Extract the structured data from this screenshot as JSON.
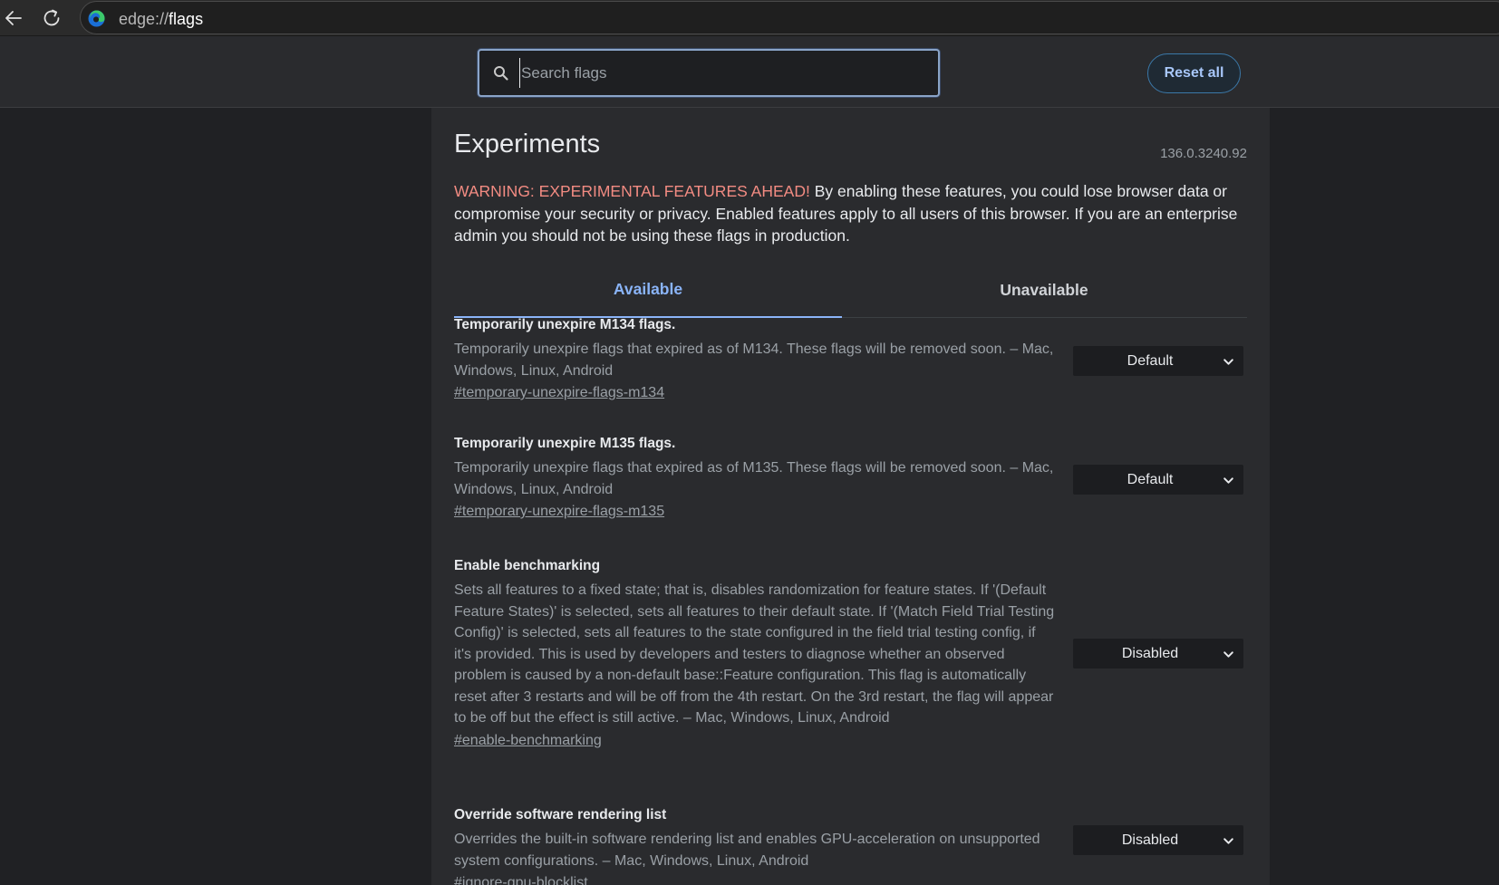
{
  "browser": {
    "address_prefix": "edge://",
    "address_main": "flags",
    "icons": {
      "back": "back-arrow-icon",
      "reload": "reload-icon",
      "logo": "edge-logo-icon"
    }
  },
  "header": {
    "search_placeholder": "Search flags",
    "search_value": "",
    "reset_label": "Reset all"
  },
  "content": {
    "title": "Experiments",
    "version": "136.0.3240.92",
    "warning_strong": "WARNING: EXPERIMENTAL FEATURES AHEAD!",
    "warning_text": " By enabling these features, you could lose browser data or compromise your security or privacy. Enabled features apply to all users of this browser. If you are an enterprise admin you should not be using these flags in production.",
    "tabs": [
      {
        "label": "Available",
        "active": true
      },
      {
        "label": "Unavailable",
        "active": false
      }
    ],
    "experiments": [
      {
        "title": "Temporarily unexpire M134 flags.",
        "description": "Temporarily unexpire flags that expired as of M134. These flags will be removed soon. – Mac, Windows, Linux, Android",
        "link": "#temporary-unexpire-flags-m134",
        "value": "Default"
      },
      {
        "title": "Temporarily unexpire M135 flags.",
        "description": "Temporarily unexpire flags that expired as of M135. These flags will be removed soon. – Mac, Windows, Linux, Android",
        "link": "#temporary-unexpire-flags-m135",
        "value": "Default"
      },
      {
        "title": "Enable benchmarking",
        "description": "Sets all features to a fixed state; that is, disables randomization for feature states. If '(Default Feature States)' is selected, sets all features to their default state. If '(Match Field Trial Testing Config)' is selected, sets all features to the state configured in the field trial testing config, if it's provided. This is used by developers and testers to diagnose whether an observed problem is caused by a non-default base::Feature configuration. This flag is automatically reset after 3 restarts and will be off from the 4th restart. On the 3rd restart, the flag will appear to be off but the effect is still active. – Mac, Windows, Linux, Android",
        "link": "#enable-benchmarking",
        "value": "Disabled"
      },
      {
        "title": "Override software rendering list",
        "description": "Overrides the built-in software rendering list and enables GPU-acceleration on unsupported system configurations. – Mac, Windows, Linux, Android",
        "link": "#ignore-gpu-blocklist",
        "value": "Disabled"
      }
    ]
  }
}
